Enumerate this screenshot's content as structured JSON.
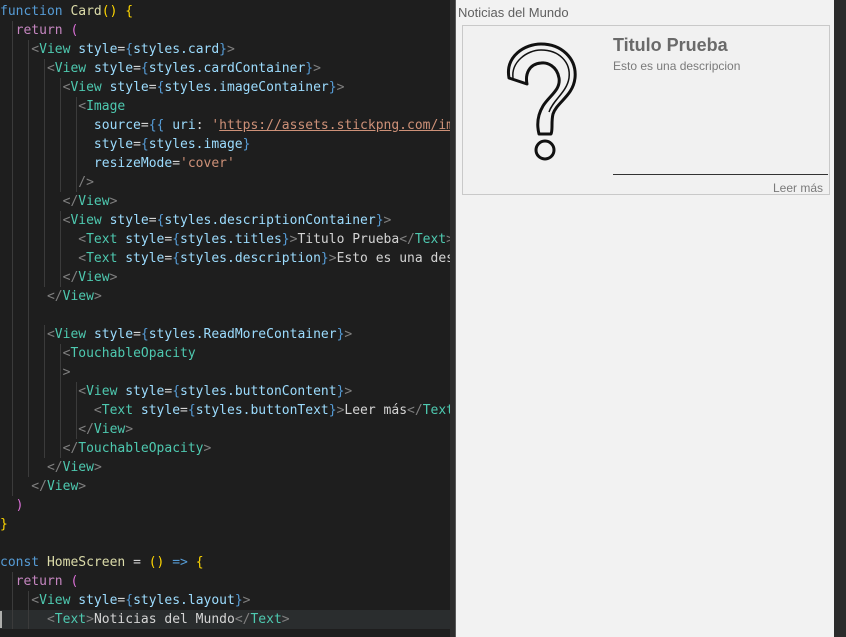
{
  "editor": {
    "lines": [
      [
        {
          "t": "function ",
          "c": "k"
        },
        {
          "t": "Card",
          "c": "f"
        },
        {
          "t": "() ",
          "c": "y"
        },
        {
          "t": "{",
          "c": "y"
        }
      ],
      [
        {
          "t": "  return ",
          "c": "o"
        },
        {
          "t": "(",
          "c": "b"
        }
      ],
      [
        {
          "t": "    <",
          "c": "p"
        },
        {
          "t": "View ",
          "c": "t"
        },
        {
          "t": "style",
          "c": "a"
        },
        {
          "t": "=",
          "c": ""
        },
        {
          "t": "{",
          "c": "k"
        },
        {
          "t": "styles.card",
          "c": "a"
        },
        {
          "t": "}",
          "c": "k"
        },
        {
          "t": ">",
          "c": "p"
        }
      ],
      [
        {
          "t": "      <",
          "c": "p"
        },
        {
          "t": "View ",
          "c": "t"
        },
        {
          "t": "style",
          "c": "a"
        },
        {
          "t": "=",
          "c": ""
        },
        {
          "t": "{",
          "c": "k"
        },
        {
          "t": "styles.cardContainer",
          "c": "a"
        },
        {
          "t": "}",
          "c": "k"
        },
        {
          "t": ">",
          "c": "p"
        }
      ],
      [
        {
          "t": "        <",
          "c": "p"
        },
        {
          "t": "View ",
          "c": "t"
        },
        {
          "t": "style",
          "c": "a"
        },
        {
          "t": "=",
          "c": ""
        },
        {
          "t": "{",
          "c": "k"
        },
        {
          "t": "styles.imageContainer",
          "c": "a"
        },
        {
          "t": "}",
          "c": "k"
        },
        {
          "t": ">",
          "c": "p"
        }
      ],
      [
        {
          "t": "          <",
          "c": "p"
        },
        {
          "t": "Image",
          "c": "t"
        }
      ],
      [
        {
          "t": "            source",
          "c": "a"
        },
        {
          "t": "=",
          "c": ""
        },
        {
          "t": "{{ ",
          "c": "k"
        },
        {
          "t": "uri",
          "c": "a"
        },
        {
          "t": ": ",
          "c": ""
        },
        {
          "t": "'",
          "c": "c"
        },
        {
          "t": "https://assets.stickpng.com/ima",
          "c": "u"
        }
      ],
      [
        {
          "t": "            style",
          "c": "a"
        },
        {
          "t": "=",
          "c": ""
        },
        {
          "t": "{",
          "c": "k"
        },
        {
          "t": "styles.image",
          "c": "a"
        },
        {
          "t": "}",
          "c": "k"
        }
      ],
      [
        {
          "t": "            resizeMode",
          "c": "a"
        },
        {
          "t": "=",
          "c": ""
        },
        {
          "t": "'cover'",
          "c": "c"
        }
      ],
      [
        {
          "t": "          />",
          "c": "p"
        }
      ],
      [
        {
          "t": "        </",
          "c": "p"
        },
        {
          "t": "View",
          "c": "t"
        },
        {
          "t": ">",
          "c": "p"
        }
      ],
      [
        {
          "t": "        <",
          "c": "p"
        },
        {
          "t": "View ",
          "c": "t"
        },
        {
          "t": "style",
          "c": "a"
        },
        {
          "t": "=",
          "c": ""
        },
        {
          "t": "{",
          "c": "k"
        },
        {
          "t": "styles.descriptionContainer",
          "c": "a"
        },
        {
          "t": "}",
          "c": "k"
        },
        {
          "t": ">",
          "c": "p"
        }
      ],
      [
        {
          "t": "          <",
          "c": "p"
        },
        {
          "t": "Text ",
          "c": "t"
        },
        {
          "t": "style",
          "c": "a"
        },
        {
          "t": "=",
          "c": ""
        },
        {
          "t": "{",
          "c": "k"
        },
        {
          "t": "styles.titles",
          "c": "a"
        },
        {
          "t": "}",
          "c": "k"
        },
        {
          "t": ">",
          "c": "p"
        },
        {
          "t": "Titulo Prueba",
          "c": ""
        },
        {
          "t": "</",
          "c": "p"
        },
        {
          "t": "Text",
          "c": "t"
        },
        {
          "t": ">",
          "c": "p"
        }
      ],
      [
        {
          "t": "          <",
          "c": "p"
        },
        {
          "t": "Text ",
          "c": "t"
        },
        {
          "t": "style",
          "c": "a"
        },
        {
          "t": "=",
          "c": ""
        },
        {
          "t": "{",
          "c": "k"
        },
        {
          "t": "styles.description",
          "c": "a"
        },
        {
          "t": "}",
          "c": "k"
        },
        {
          "t": ">",
          "c": "p"
        },
        {
          "t": "Esto es una desc",
          "c": ""
        }
      ],
      [
        {
          "t": "        </",
          "c": "p"
        },
        {
          "t": "View",
          "c": "t"
        },
        {
          "t": ">",
          "c": "p"
        }
      ],
      [
        {
          "t": "      </",
          "c": "p"
        },
        {
          "t": "View",
          "c": "t"
        },
        {
          "t": ">",
          "c": "p"
        }
      ],
      [],
      [
        {
          "t": "      <",
          "c": "p"
        },
        {
          "t": "View ",
          "c": "t"
        },
        {
          "t": "style",
          "c": "a"
        },
        {
          "t": "=",
          "c": ""
        },
        {
          "t": "{",
          "c": "k"
        },
        {
          "t": "styles.ReadMoreContainer",
          "c": "a"
        },
        {
          "t": "}",
          "c": "k"
        },
        {
          "t": ">",
          "c": "p"
        }
      ],
      [
        {
          "t": "        <",
          "c": "p"
        },
        {
          "t": "TouchableOpacity",
          "c": "t"
        }
      ],
      [
        {
          "t": "        >",
          "c": "p"
        }
      ],
      [
        {
          "t": "          <",
          "c": "p"
        },
        {
          "t": "View ",
          "c": "t"
        },
        {
          "t": "style",
          "c": "a"
        },
        {
          "t": "=",
          "c": ""
        },
        {
          "t": "{",
          "c": "k"
        },
        {
          "t": "styles.buttonContent",
          "c": "a"
        },
        {
          "t": "}",
          "c": "k"
        },
        {
          "t": ">",
          "c": "p"
        }
      ],
      [
        {
          "t": "            <",
          "c": "p"
        },
        {
          "t": "Text ",
          "c": "t"
        },
        {
          "t": "style",
          "c": "a"
        },
        {
          "t": "=",
          "c": ""
        },
        {
          "t": "{",
          "c": "k"
        },
        {
          "t": "styles.buttonText",
          "c": "a"
        },
        {
          "t": "}",
          "c": "k"
        },
        {
          "t": ">",
          "c": "p"
        },
        {
          "t": "Leer más",
          "c": ""
        },
        {
          "t": "</",
          "c": "p"
        },
        {
          "t": "Text",
          "c": "t"
        },
        {
          "t": ">",
          "c": "p"
        }
      ],
      [
        {
          "t": "          </",
          "c": "p"
        },
        {
          "t": "View",
          "c": "t"
        },
        {
          "t": ">",
          "c": "p"
        }
      ],
      [
        {
          "t": "        </",
          "c": "p"
        },
        {
          "t": "TouchableOpacity",
          "c": "t"
        },
        {
          "t": ">",
          "c": "p"
        }
      ],
      [
        {
          "t": "      </",
          "c": "p"
        },
        {
          "t": "View",
          "c": "t"
        },
        {
          "t": ">",
          "c": "p"
        }
      ],
      [
        {
          "t": "    </",
          "c": "p"
        },
        {
          "t": "View",
          "c": "t"
        },
        {
          "t": ">",
          "c": "p"
        }
      ],
      [
        {
          "t": "  )",
          "c": "b"
        }
      ],
      [
        {
          "t": "}",
          "c": "y"
        }
      ],
      [],
      [
        {
          "t": "const ",
          "c": "k"
        },
        {
          "t": "HomeScreen",
          "c": "f"
        },
        {
          "t": " = ",
          "c": ""
        },
        {
          "t": "()",
          "c": "y"
        },
        {
          "t": " => ",
          "c": "k"
        },
        {
          "t": "{",
          "c": "y"
        }
      ],
      [
        {
          "t": "  return ",
          "c": "o"
        },
        {
          "t": "(",
          "c": "b"
        }
      ],
      [
        {
          "t": "    <",
          "c": "p"
        },
        {
          "t": "View ",
          "c": "t"
        },
        {
          "t": "style",
          "c": "a"
        },
        {
          "t": "=",
          "c": ""
        },
        {
          "t": "{",
          "c": "k"
        },
        {
          "t": "styles.layout",
          "c": "a"
        },
        {
          "t": "}",
          "c": "k"
        },
        {
          "t": ">",
          "c": "p"
        }
      ],
      [
        {
          "t": "      <",
          "c": "p"
        },
        {
          "t": "Text",
          "c": "t"
        },
        {
          "t": ">",
          "c": "p"
        },
        {
          "t": "Noticias del Mundo",
          "c": ""
        },
        {
          "t": "</",
          "c": "p"
        },
        {
          "t": "Text",
          "c": "t"
        },
        {
          "t": ">",
          "c": "p"
        }
      ]
    ],
    "highlight_line": 33
  },
  "preview": {
    "app_title": "Noticias del Mundo",
    "card": {
      "image_icon": "question-mark-icon",
      "title": "Titulo Prueba",
      "description": "Esto es una descripcion",
      "read_more": "Leer más"
    }
  },
  "colors": {
    "editor_bg": "#1e1e1e",
    "preview_bg": "#f2f2f2",
    "keyword": "#569cd6",
    "tag": "#4ec9b0",
    "attribute": "#9cdcfe",
    "string": "#ce9178"
  }
}
